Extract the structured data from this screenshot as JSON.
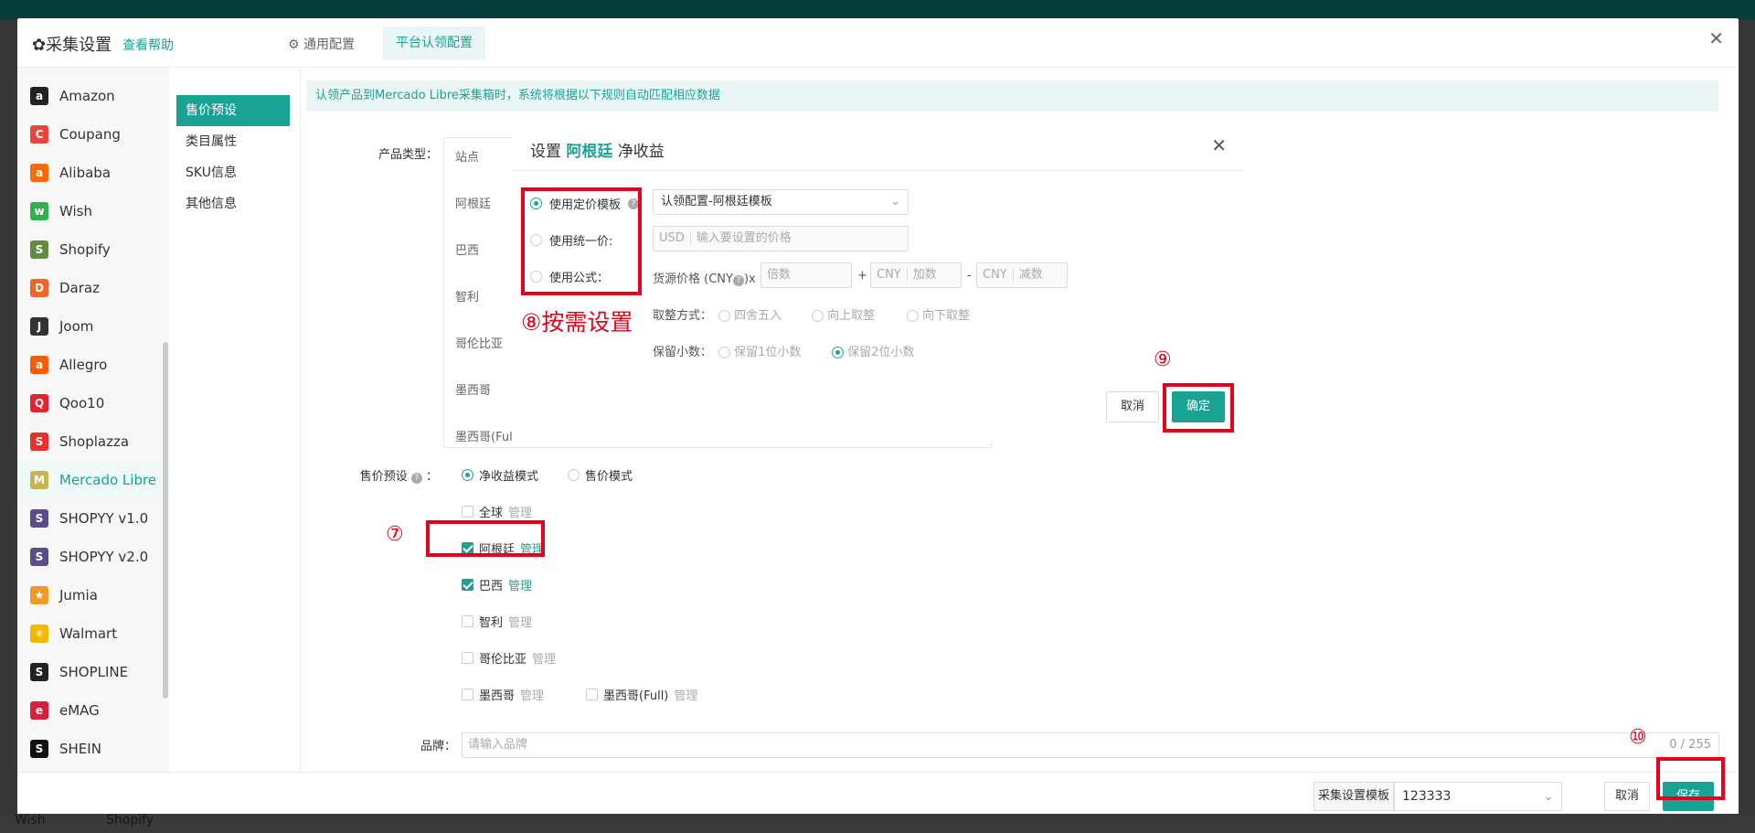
{
  "background": {
    "bottom_left_items": [
      "Wish",
      "Shopify"
    ]
  },
  "main": {
    "title": "采集设置",
    "help_link": "查看帮助",
    "tabs": [
      {
        "label": "通用配置"
      },
      {
        "label": "平台认领配置"
      }
    ],
    "platforms": [
      {
        "label": "Amazon",
        "icon": "amazon-icon",
        "color": "#222222",
        "glyph": "a"
      },
      {
        "label": "Coupang",
        "icon": "coupang-icon",
        "color": "#e8463a",
        "glyph": "C"
      },
      {
        "label": "Alibaba",
        "icon": "alibaba-icon",
        "color": "#ff6a00",
        "glyph": "a"
      },
      {
        "label": "Wish",
        "icon": "wish-icon",
        "color": "#2fb24c",
        "glyph": "w"
      },
      {
        "label": "Shopify",
        "icon": "shopify-icon",
        "color": "#5e8e3e",
        "glyph": "S"
      },
      {
        "label": "Daraz",
        "icon": "daraz-icon",
        "color": "#f3642a",
        "glyph": "D"
      },
      {
        "label": "Joom",
        "icon": "joom-icon",
        "color": "#333333",
        "glyph": "J"
      },
      {
        "label": "Allegro",
        "icon": "allegro-icon",
        "color": "#ff5a00",
        "glyph": "a"
      },
      {
        "label": "Qoo10",
        "icon": "qoo10-icon",
        "color": "#e8212e",
        "glyph": "Q"
      },
      {
        "label": "Shoplazza",
        "icon": "shoplazza-icon",
        "color": "#e9302c",
        "glyph": "S"
      },
      {
        "label": "Mercado Libre",
        "icon": "mercado-libre-icon",
        "color": "#c9b64b",
        "glyph": "M"
      },
      {
        "label": "SHOPYY v1.0",
        "icon": "shopyy-icon",
        "color": "#5b4c8a",
        "glyph": "S"
      },
      {
        "label": "SHOPYY v2.0",
        "icon": "shopyy-icon",
        "color": "#5b4c8a",
        "glyph": "S"
      },
      {
        "label": "Jumia",
        "icon": "jumia-icon",
        "color": "#f19a29",
        "glyph": "★"
      },
      {
        "label": "Walmart",
        "icon": "walmart-icon",
        "color": "#f5b700",
        "glyph": "✳"
      },
      {
        "label": "SHOPLINE",
        "icon": "shopline-icon",
        "color": "#222222",
        "glyph": "S"
      },
      {
        "label": "eMAG",
        "icon": "emag-icon",
        "color": "#d7213c",
        "glyph": "e"
      },
      {
        "label": "SHEIN",
        "icon": "shein-icon",
        "color": "#111111",
        "glyph": "S"
      }
    ],
    "active_platform": "Mercado Libre",
    "sub_nav": [
      {
        "label": "售价预设"
      },
      {
        "label": "类目属性"
      },
      {
        "label": "SKU信息"
      },
      {
        "label": "其他信息"
      }
    ],
    "notice": "认领产品到Mercado Libre采集箱时，系统将根据以下规则自动匹配相应数据",
    "product_type_label": "产品类型：",
    "table_header": "站点",
    "table_rows": [
      "阿根廷",
      "巴西",
      "智利",
      "哥伦比亚",
      "墨西哥",
      "墨西哥(Ful"
    ],
    "price_preset_label": "售价预设",
    "mode_options": [
      "净收益模式",
      "售价模式"
    ],
    "sites": [
      {
        "label": "全球",
        "checked": false,
        "manage": "管理"
      },
      {
        "label": "阿根廷",
        "checked": true,
        "manage": "管理"
      },
      {
        "label": "巴西",
        "checked": true,
        "manage": "管理"
      },
      {
        "label": "智利",
        "checked": false,
        "manage": "管理"
      },
      {
        "label": "哥伦比亚",
        "checked": false,
        "manage": "管理"
      },
      {
        "label": "墨西哥",
        "checked": false,
        "manage": "管理"
      },
      {
        "label": "墨西哥(Full)",
        "checked": false,
        "manage": "管理"
      }
    ],
    "brand_label": "品牌：",
    "brand_placeholder": "请输入品牌",
    "brand_count": "0 / 255",
    "footer": {
      "template_label": "采集设置模板",
      "template_value": "123333",
      "cancel": "取消",
      "save": "保存"
    }
  },
  "dialog": {
    "title_prefix": "设置",
    "title_site": "阿根廷",
    "title_suffix": "净收益",
    "options": [
      "使用定价模板",
      "使用统一价:",
      "使用公式："
    ],
    "template_select": "认领配置-阿根廷模板",
    "unified_currency": "USD",
    "unified_placeholder": "输入要设置的价格",
    "formula_label": "货源价格 (CNY",
    "formula_suffix": ")x",
    "multiplier_placeholder": "倍数",
    "plus": "+",
    "add_currency": "CNY",
    "add_placeholder": "加数",
    "minus": "-",
    "sub_currency": "CNY",
    "sub_placeholder": "减数",
    "rounding_label": "取整方式：",
    "rounding_options": [
      "四舍五入",
      "向上取整",
      "向下取整"
    ],
    "decimal_label": "保留小数：",
    "decimal_options": [
      "保留1位小数",
      "保留2位小数"
    ],
    "cancel": "取消",
    "confirm": "确定"
  },
  "annotations": {
    "step7": "⑦",
    "step8": "⑧按需设置",
    "step9": "⑨",
    "step10": "⑩",
    "highlight_color": "#e8001c"
  },
  "colors": {
    "accent": "#1aa394"
  }
}
